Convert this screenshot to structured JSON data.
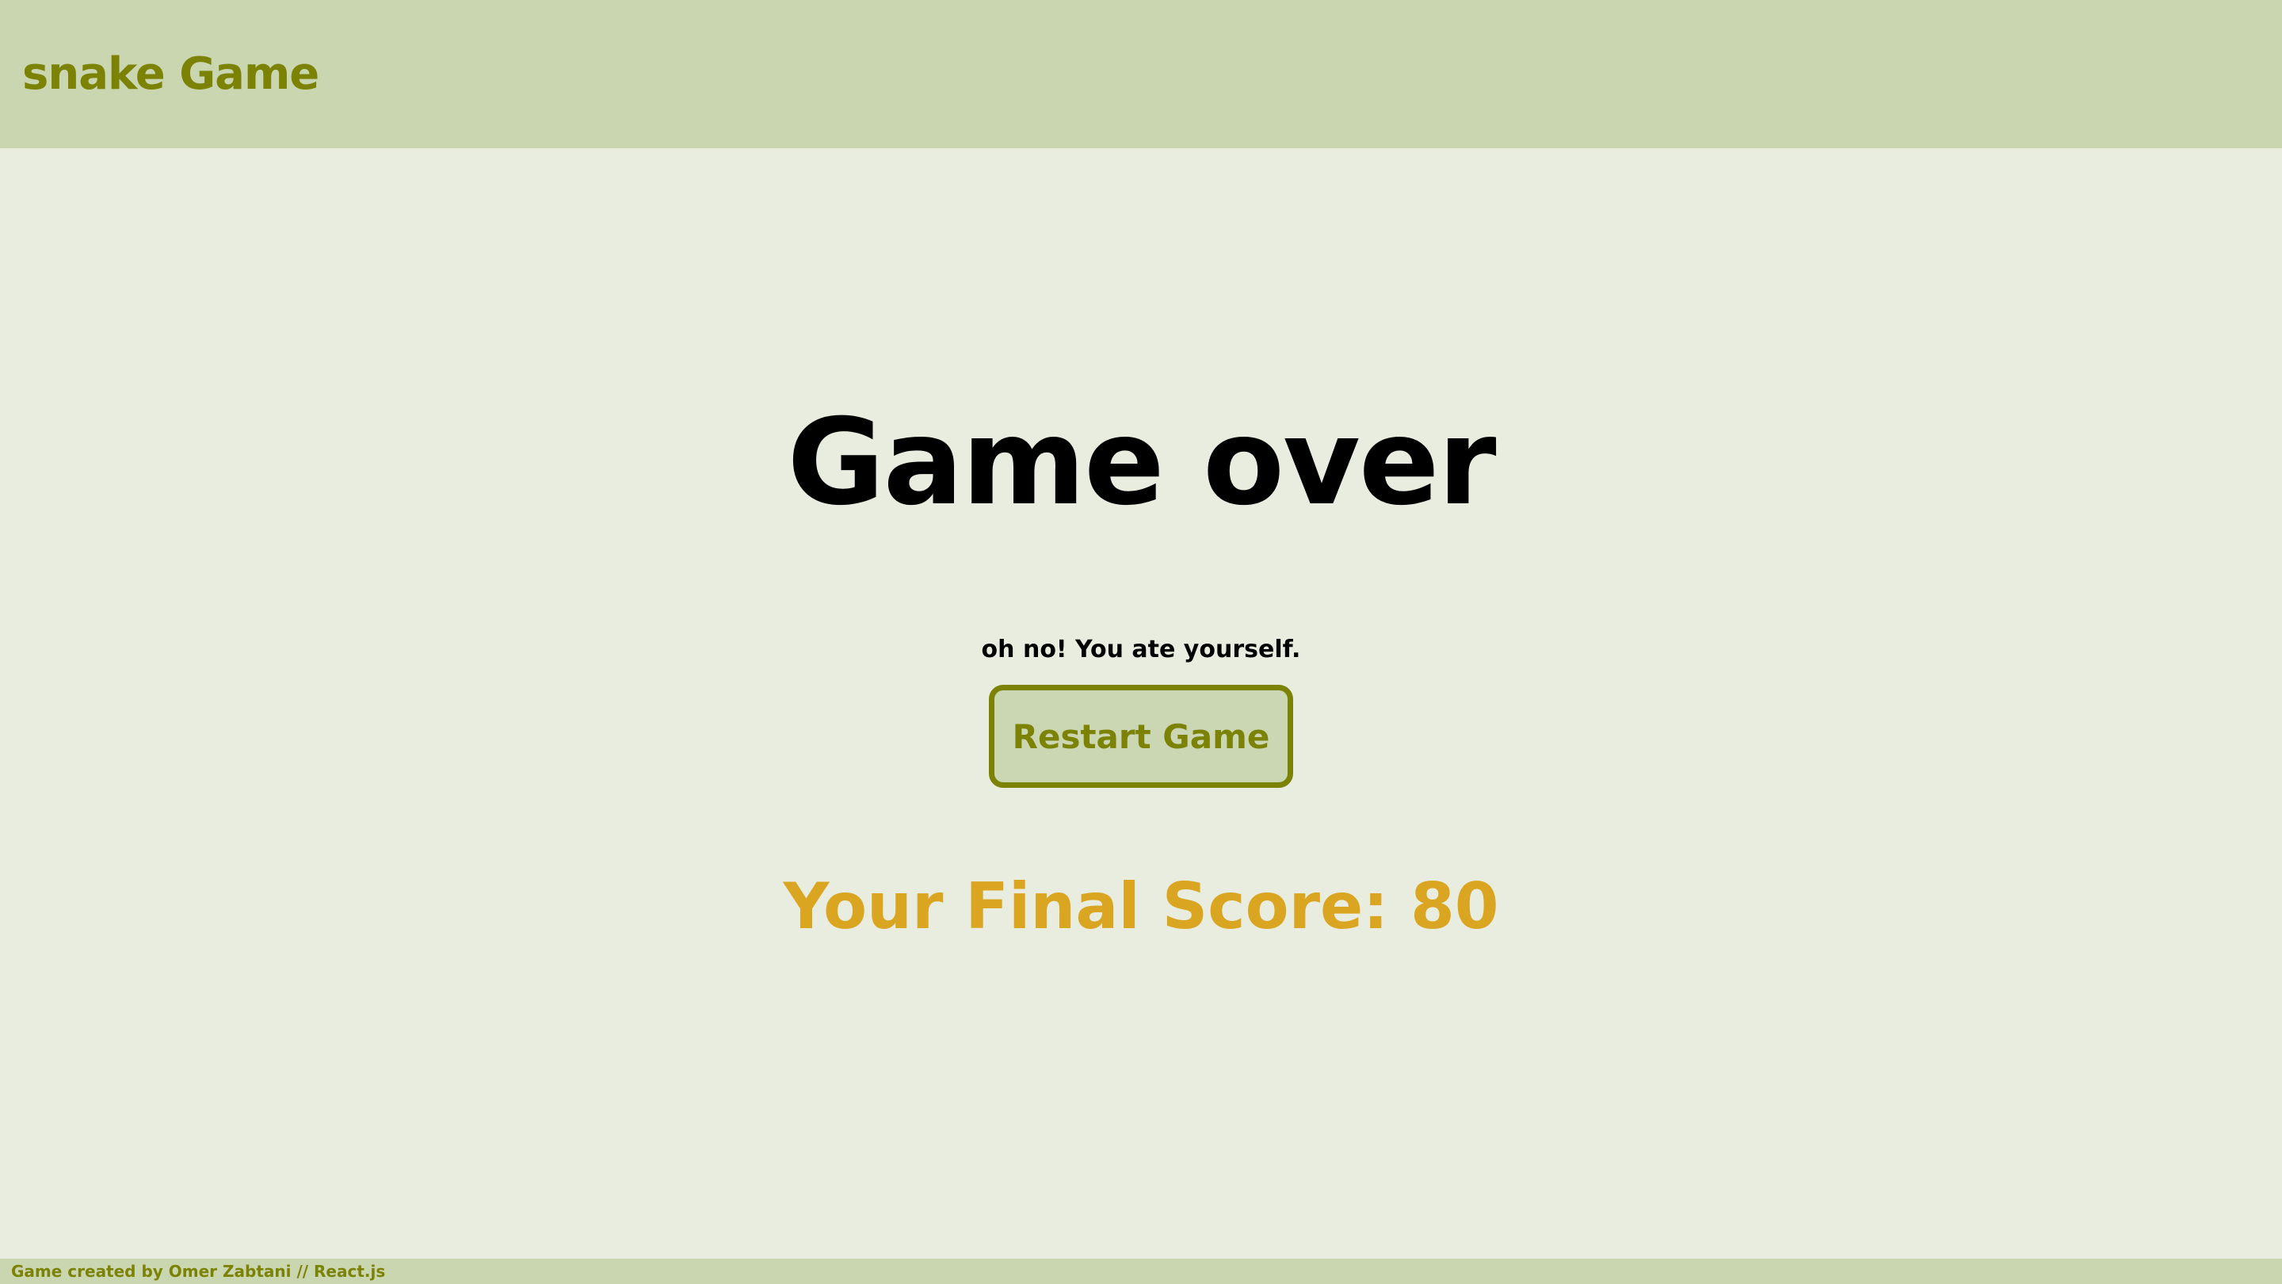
{
  "header": {
    "title": "snake Game"
  },
  "game_over": {
    "title": "Game over",
    "message": "oh no! You ate yourself.",
    "restart_label": "Restart Game",
    "final_score_label": "Your Final Score:",
    "final_score": 80
  },
  "footer": {
    "credit": "Game created by Omer Zabtani // React.js"
  },
  "colors": {
    "header_bg": "#c9d6b0",
    "page_bg": "#e9eddf",
    "accent_olive": "#7b8204",
    "score_gold": "#daa520"
  }
}
